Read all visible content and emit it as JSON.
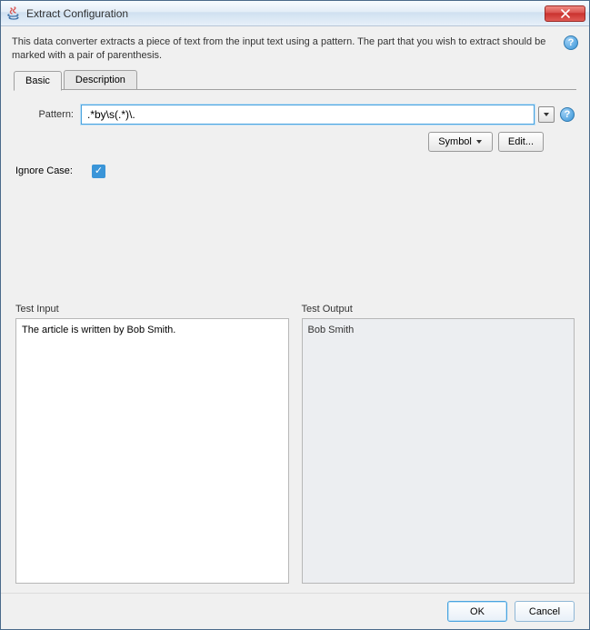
{
  "window": {
    "title": "Extract Configuration"
  },
  "description": "This data converter extracts a piece of text from the input text using a pattern. The part that you wish to extract should be marked with a pair of parenthesis.",
  "help_glyph": "?",
  "tabs": {
    "basic": "Basic",
    "description": "Description",
    "active": "basic"
  },
  "fields": {
    "pattern_label": "Pattern:",
    "pattern_value": ".*by\\s(.*)\\.",
    "symbol_button": "Symbol",
    "edit_button": "Edit...",
    "ignore_case_label": "Ignore Case:",
    "ignore_case_checked": true
  },
  "test": {
    "input_label": "Test Input",
    "output_label": "Test Output",
    "input_value": "The article is written by Bob Smith.",
    "output_value": "Bob Smith"
  },
  "buttons": {
    "ok": "OK",
    "cancel": "Cancel"
  }
}
